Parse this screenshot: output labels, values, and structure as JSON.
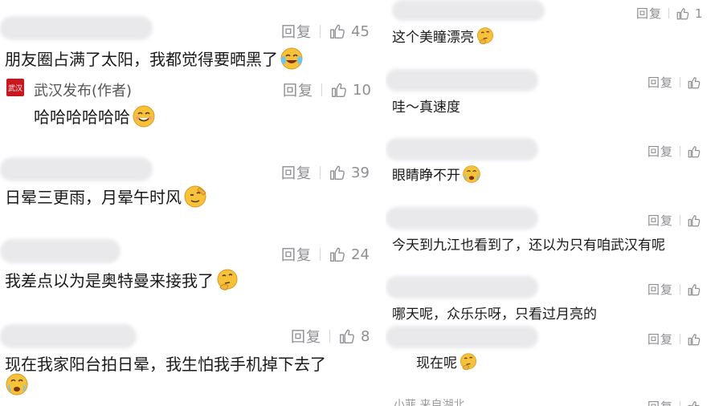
{
  "left_comments": [
    {
      "reply": "回复",
      "likes": "45",
      "text": "朋友圈占满了太阳，我都觉得要晒黑了",
      "emoji": "laughing-tears-icon"
    },
    {
      "author": "武汉发布(作者)",
      "logo_text": "武汉",
      "reply": "回复",
      "likes": "10",
      "text": "哈哈哈哈哈哈",
      "emoji": "grin-icon"
    },
    {
      "reply": "回复",
      "likes": "39",
      "text": "日晕三更雨，月晕午时风",
      "emoji": "salute-icon"
    },
    {
      "reply": "回复",
      "likes": "24",
      "text": "我差点以为是奥特曼来接我了",
      "emoji": "thinking-icon"
    },
    {
      "reply": "回复",
      "likes": "8",
      "text": "现在我家阳台拍日晕，我生怕我手机掉下去了",
      "emoji": "crying-icon"
    }
  ],
  "right_comments": [
    {
      "reply": "回复",
      "likes": "1",
      "text": "这个美瞳漂亮",
      "emoji": "thinking-icon"
    },
    {
      "reply": "回复",
      "likes": "",
      "text": "哇～真速度",
      "emoji": ""
    },
    {
      "reply": "回复",
      "likes": "",
      "text": "眼睛睁不开",
      "emoji": "crying-icon"
    },
    {
      "reply": "回复",
      "likes": "",
      "text": "今天到九江也看到了，还以为只有咱武汉有呢",
      "emoji": ""
    },
    {
      "reply": "回复",
      "likes": "",
      "text": "哪天呢，众乐乐呀，只看过月亮的",
      "emoji": ""
    },
    {
      "reply": "回复",
      "likes": "",
      "text": "现在呢",
      "emoji": "thinking-icon"
    },
    {
      "reply": "回复",
      "likes": "",
      "text": "",
      "emoji": "",
      "cut_name": "小菲  来自湖北"
    }
  ]
}
